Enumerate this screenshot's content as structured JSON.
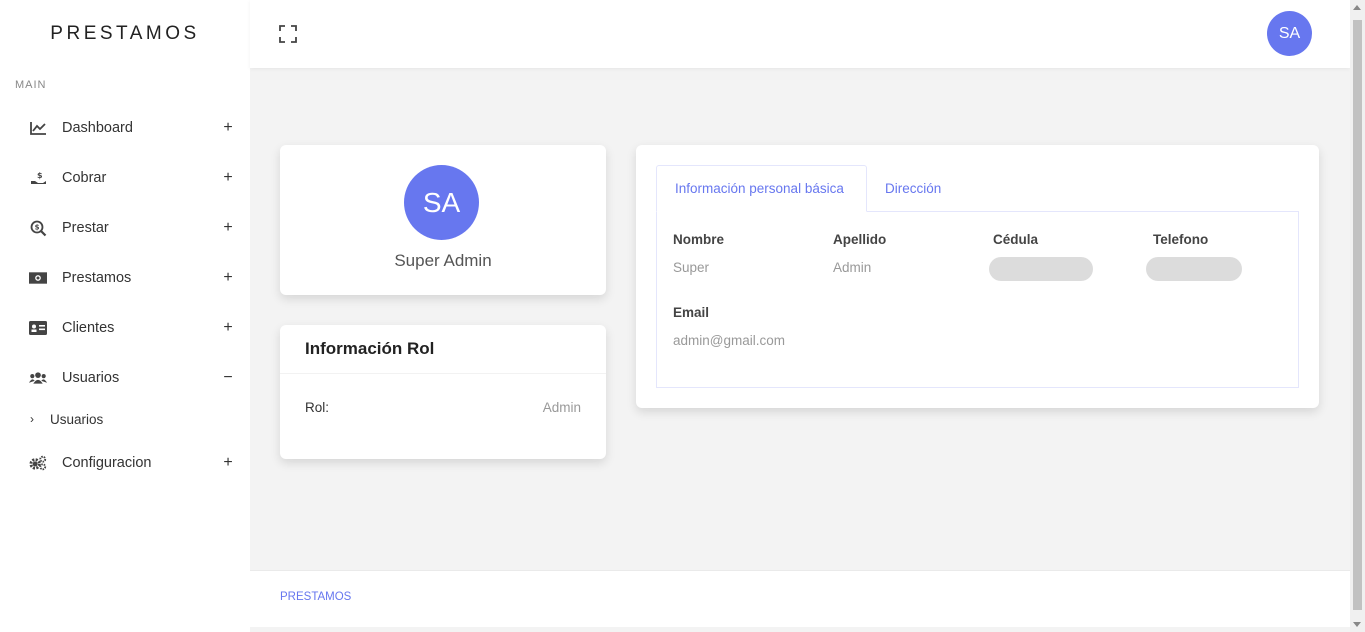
{
  "brand": "PRESTAMOS",
  "sidebar": {
    "section_title": "MAIN",
    "items": [
      {
        "label": "Dashboard",
        "toggle": "+",
        "icon": "chart-line-icon"
      },
      {
        "label": "Cobrar",
        "toggle": "+",
        "icon": "hand-holding-dollar-icon"
      },
      {
        "label": "Prestar",
        "toggle": "+",
        "icon": "search-dollar-icon"
      },
      {
        "label": "Prestamos",
        "toggle": "+",
        "icon": "money-bill-icon"
      },
      {
        "label": "Clientes",
        "toggle": "+",
        "icon": "id-card-icon"
      },
      {
        "label": "Usuarios",
        "toggle": "−",
        "icon": "users-icon"
      },
      {
        "label": "Configuracion",
        "toggle": "+",
        "icon": "cogs-icon"
      }
    ],
    "submenu": [
      {
        "label": "Usuarios",
        "chevron": "›"
      }
    ]
  },
  "topbar": {
    "avatar_initials": "SA"
  },
  "profile": {
    "initials": "SA",
    "name": "Super Admin"
  },
  "role_card": {
    "title": "Información Rol",
    "label": "Rol:",
    "value": "Admin"
  },
  "info_card": {
    "tabs": [
      "Información personal básica",
      "Dirección"
    ],
    "fields": {
      "nombre_label": "Nombre",
      "nombre_value": "Super",
      "apellido_label": "Apellido",
      "apellido_value": "Admin",
      "cedula_label": "Cédula",
      "telefono_label": "Telefono",
      "email_label": "Email",
      "email_value": "admin@gmail.com"
    }
  },
  "footer": {
    "text": "PRESTAMOS"
  },
  "colors": {
    "accent": "#6777ef",
    "background": "#f3f3f3"
  }
}
